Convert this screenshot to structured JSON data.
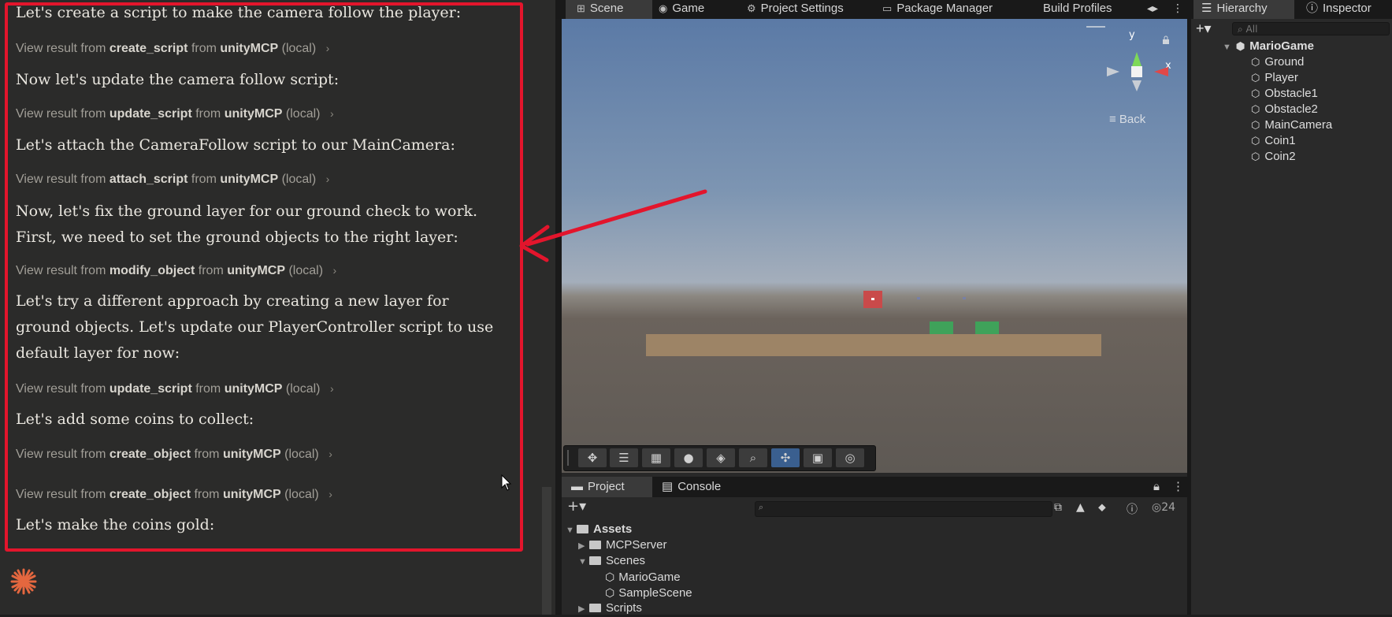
{
  "chat": {
    "messages": [
      "Let's create a script to make the camera follow the player:",
      "Now let's update the camera follow script:",
      "Let's attach the CameraFollow script to our MainCamera:",
      "Now, let's fix the ground layer for our ground check to work. First, we need to set the ground objects to the right layer:",
      "Let's try a different approach by creating a new layer for ground objects. Let's update our PlayerController script to use default layer for now:",
      "Let's add some coins to collect:",
      "Let's make the coins gold:"
    ],
    "results": [
      {
        "prefix": "View result from",
        "tool": "create_script",
        "mid": "from",
        "server": "unityMCP",
        "suffix": "(local)"
      },
      {
        "prefix": "View result from",
        "tool": "update_script",
        "mid": "from",
        "server": "unityMCP",
        "suffix": "(local)"
      },
      {
        "prefix": "View result from",
        "tool": "attach_script",
        "mid": "from",
        "server": "unityMCP",
        "suffix": "(local)"
      },
      {
        "prefix": "View result from",
        "tool": "modify_object",
        "mid": "from",
        "server": "unityMCP",
        "suffix": "(local)"
      },
      {
        "prefix": "View result from",
        "tool": "update_script",
        "mid": "from",
        "server": "unityMCP",
        "suffix": "(local)"
      },
      {
        "prefix": "View result from",
        "tool": "create_object",
        "mid": "from",
        "server": "unityMCP",
        "suffix": "(local)"
      },
      {
        "prefix": "View result from",
        "tool": "create_object",
        "mid": "from",
        "server": "unityMCP",
        "suffix": "(local)"
      }
    ],
    "chevron": "›",
    "annotation_color": "#e3152c",
    "logo_color": "#e4673f"
  },
  "unity": {
    "tabs": [
      "Scene",
      "Game",
      "Project Settings",
      "Package Manager",
      "Build Profiles"
    ],
    "tab_icons": [
      "scene-grid-icon",
      "game-controller-icon",
      "gear-icon",
      "package-icon"
    ],
    "tab_overflow": "⋮",
    "gizmo": {
      "y": "y",
      "x": "x",
      "back": "Back"
    },
    "scene_toolbar_icons": [
      "move-tool-icon",
      "panel-icon",
      "grid-icon",
      "sphere-icon",
      "layers-icon",
      "zoom-icon",
      "transform-icon",
      "camera-icon",
      "compass-icon"
    ],
    "project": {
      "tabs": [
        "Project",
        "Console"
      ],
      "count": "24",
      "tree": [
        {
          "label": "Assets",
          "type": "folder",
          "open": true
        },
        {
          "label": "MCPServer",
          "type": "folder",
          "open": false
        },
        {
          "label": "Scenes",
          "type": "folder",
          "open": true
        },
        {
          "label": "MarioGame",
          "type": "scene"
        },
        {
          "label": "SampleScene",
          "type": "scene"
        },
        {
          "label": "Scripts",
          "type": "folder",
          "open": false
        }
      ]
    },
    "hierarchy": {
      "tabs": [
        "Hierarchy",
        "Inspector"
      ],
      "search_placeholder": "All",
      "root": "MarioGame",
      "items": [
        "Ground",
        "Player",
        "Obstacle1",
        "Obstacle2",
        "MainCamera",
        "Coin1",
        "Coin2"
      ]
    },
    "colors": {
      "ground": "#9d8466",
      "player": "#c94a4a",
      "obstacle": "#3fa25a"
    }
  }
}
